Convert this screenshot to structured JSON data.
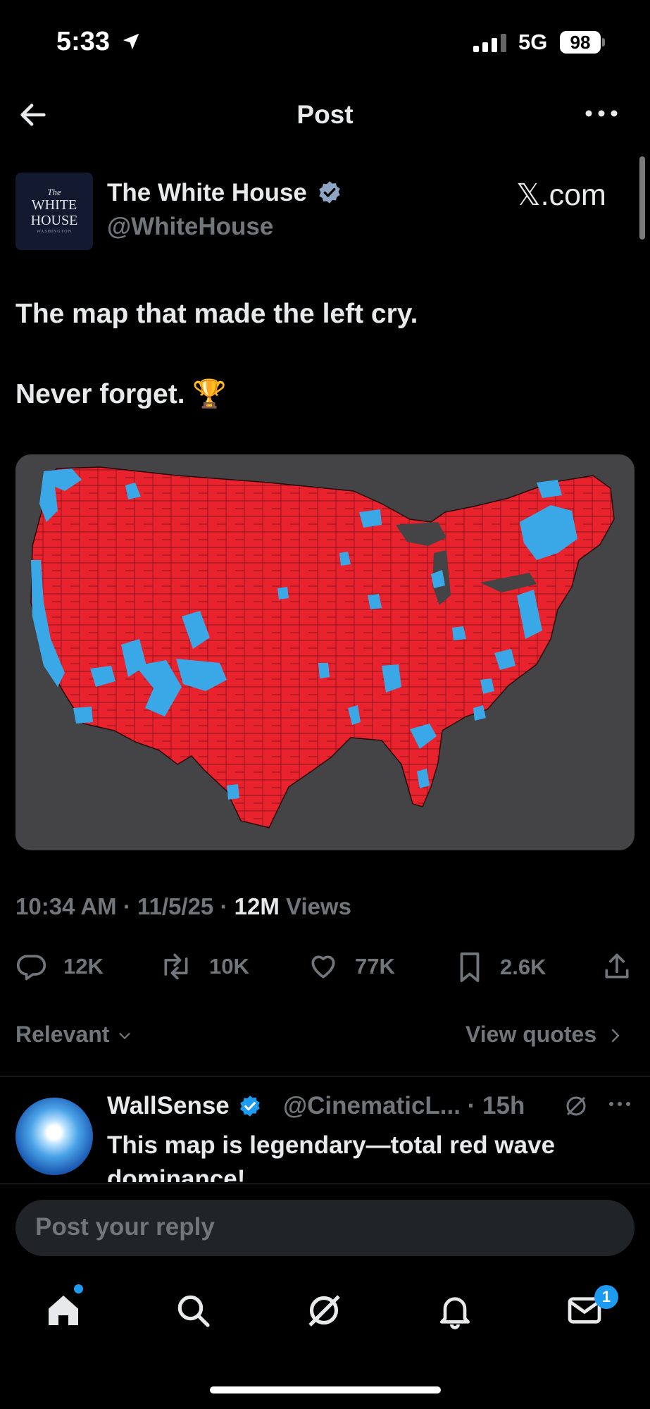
{
  "status_bar": {
    "time": "5:33",
    "network": "5G",
    "battery": "98"
  },
  "header": {
    "title": "Post"
  },
  "post": {
    "author_name": "The White House",
    "author_handle": "@WhiteHouse",
    "avatar_text": {
      "line1": "The",
      "line2": "WHITE",
      "line3": "HOUSE",
      "line4": "WASHINGTON"
    },
    "source_label": "𝕏.com",
    "text_line1": "The map that made the left cry.",
    "text_line2": "Never forget. 🏆",
    "time": "10:34 AM",
    "date": "11/5/25",
    "views_count": "12M",
    "views_label": "Views",
    "replies": "12K",
    "reposts": "10K",
    "likes": "77K",
    "bookmarks": "2.6K"
  },
  "sort": {
    "label": "Relevant",
    "quotes_label": "View quotes"
  },
  "reply": {
    "name": "WallSense",
    "handle_time": "@CinematicL... · 15h",
    "text": "This map is legendary—total red wave dominance!"
  },
  "composer": {
    "placeholder": "Post your reply"
  },
  "nav": {
    "messages_badge": "1"
  },
  "colors": {
    "red": "#e8232e",
    "blue": "#3aa8e6",
    "map_bg": "#444446",
    "accent": "#1d9bf0",
    "muted": "#71767b"
  }
}
